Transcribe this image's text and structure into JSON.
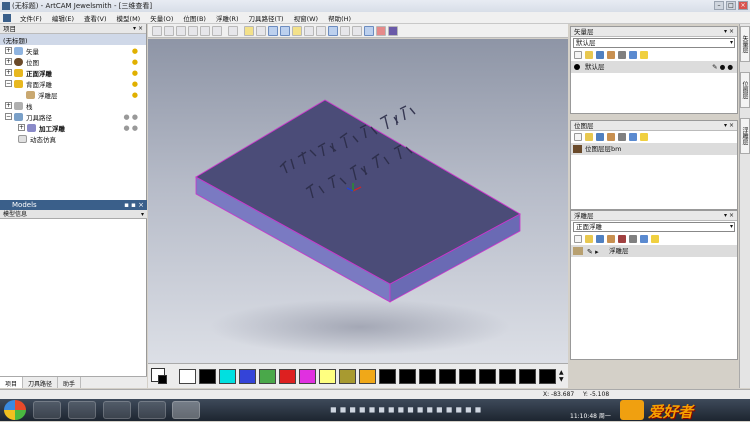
{
  "window": {
    "title": "(无标题) - ArtCAM Jewelsmith - [三维查看]"
  },
  "menu": [
    "文件(F)",
    "编辑(E)",
    "查看(V)",
    "模型(M)",
    "矢量(O)",
    "位图(B)",
    "浮雕(R)",
    "刀具路径(T)",
    "视窗(W)",
    "帮助(H)"
  ],
  "project": {
    "header": "项目",
    "root": "(无标题)",
    "items": [
      {
        "label": "矢量"
      },
      {
        "label": "位图"
      },
      {
        "label": "正面浮雕"
      },
      {
        "label": "背面浮雕"
      },
      {
        "label": "浮雕层"
      },
      {
        "label": "栈"
      },
      {
        "label": "刀具路径"
      },
      {
        "label": "加工浮雕"
      },
      {
        "label": "动态仿真"
      }
    ]
  },
  "models": {
    "title": "Models",
    "subtitle": "模型信息"
  },
  "left_tabs": [
    "项目",
    "刀具路径",
    "助手"
  ],
  "vector_layers": {
    "title": "矢量层",
    "select": "默认层",
    "row": "默认层"
  },
  "bitmap_layers": {
    "title": "位图层",
    "row": "位图层层bm"
  },
  "relief_layers": {
    "title": "浮雕层",
    "select": "正面浮雕",
    "row": "浮雕层"
  },
  "side_tabs": [
    "矢量层",
    "位图层",
    "浮雕层"
  ],
  "status": {
    "x": "X: -83.687",
    "y": "Y: -5.108"
  },
  "taskbar": {
    "time": "11:10:48 周一"
  },
  "watermark": "爱好者",
  "colors": {
    "viewport_plate_top": "#4b4c78",
    "plate_edge": "#cc33cc",
    "swatches": [
      "#ffffff",
      "#000000",
      "#00e0e0",
      "#3444d8",
      "#4aa84a",
      "#dd2020",
      "#e030e0",
      "#ffff80",
      "#a89a30",
      "#f0a818",
      "#000000",
      "#000000",
      "#000000",
      "#000000",
      "#000000",
      "#000000",
      "#000000",
      "#000000"
    ]
  }
}
